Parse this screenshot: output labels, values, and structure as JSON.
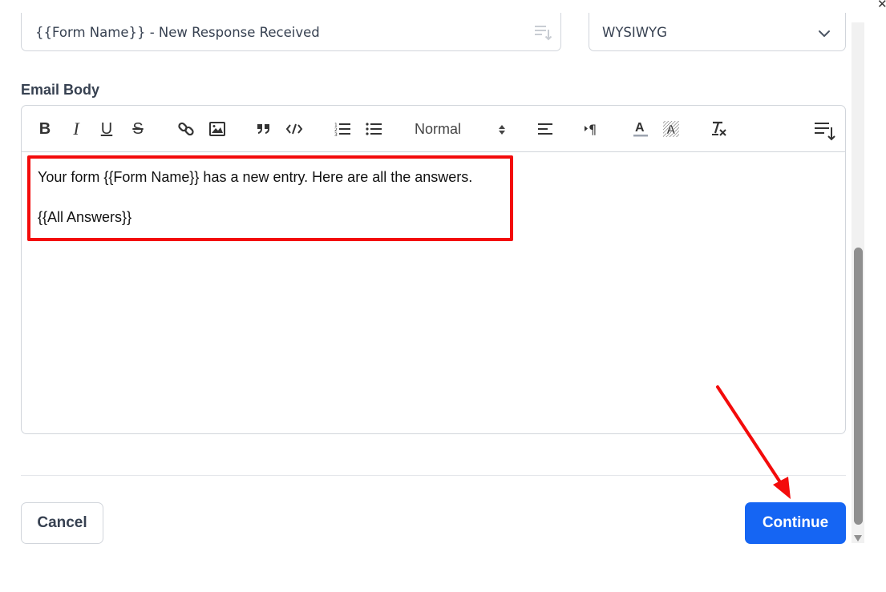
{
  "subject": {
    "value": "{{Form Name}} - New Response Received",
    "insert_icon": "list-insert-icon"
  },
  "format": {
    "selected": "WYSIWYG",
    "icon": "chevron-down-icon"
  },
  "email_body": {
    "label": "Email Body",
    "toolbar": {
      "bold": "B",
      "italic": "I",
      "underline": "U",
      "strike": "S",
      "header_select": "Normal",
      "icons": [
        "bold-icon",
        "italic-icon",
        "underline-icon",
        "strikethrough-icon",
        "link-icon",
        "image-icon",
        "blockquote-icon",
        "code-block-icon",
        "ordered-list-icon",
        "bullet-list-icon",
        "align-left-icon",
        "text-direction-icon",
        "text-color-icon",
        "background-color-icon",
        "clear-format-icon",
        "insert-shortcode-icon"
      ]
    },
    "lines": [
      "Your form {{Form Name}} has a new entry. Here are all the answers.",
      "{{All Answers}}"
    ]
  },
  "footer": {
    "cancel_label": "Cancel",
    "continue_label": "Continue"
  },
  "colors": {
    "primary": "#1565f3",
    "annotation_red": "#f30b0b",
    "border": "#d1d5db"
  }
}
